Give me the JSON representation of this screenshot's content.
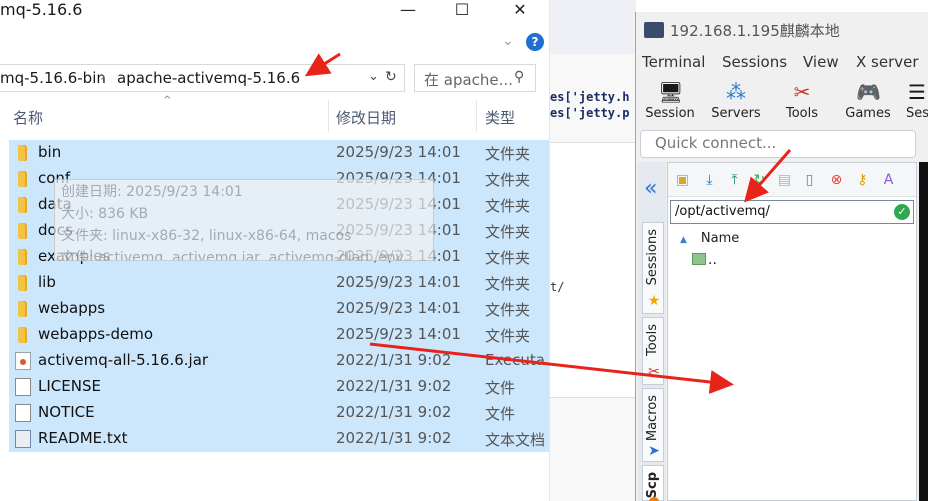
{
  "explorer": {
    "title": "mq-5.16.6",
    "window_controls": [
      "—",
      "☐",
      "✕"
    ],
    "address_segments": [
      "mq-5.16.6-bin",
      "apache-activemq-5.16.6"
    ],
    "address_separator": "›",
    "search_placeholder": "在 apache...",
    "columns": [
      "名称",
      "修改日期",
      "类型"
    ],
    "files": [
      {
        "name": "bin",
        "date": "2025/9/23 14:01",
        "type": "文件夹",
        "icon": "folder-icon"
      },
      {
        "name": "conf",
        "date": "2025/9/23 14:01",
        "type": "文件夹",
        "icon": "folder-icon"
      },
      {
        "name": "data",
        "date": "2025/9/23 14:01",
        "type": "文件夹",
        "icon": "folder-icon"
      },
      {
        "name": "docs",
        "date": "2025/9/23 14:01",
        "type": "文件夹",
        "icon": "folder-icon"
      },
      {
        "name": "examples",
        "date": "2025/9/23 14:01",
        "type": "文件夹",
        "icon": "folder-icon"
      },
      {
        "name": "lib",
        "date": "2025/9/23 14:01",
        "type": "文件夹",
        "icon": "folder-icon"
      },
      {
        "name": "webapps",
        "date": "2025/9/23 14:01",
        "type": "文件夹",
        "icon": "folder-icon"
      },
      {
        "name": "webapps-demo",
        "date": "2025/9/23 14:01",
        "type": "文件夹",
        "icon": "folder-icon"
      },
      {
        "name": "activemq-all-5.16.6.jar",
        "date": "2022/1/31 9:02",
        "type": "Executab",
        "icon": "java-jar-icon"
      },
      {
        "name": "LICENSE",
        "date": "2022/1/31 9:02",
        "type": "文件",
        "icon": "file-icon"
      },
      {
        "name": "NOTICE",
        "date": "2022/1/31 9:02",
        "type": "文件",
        "icon": "file-icon"
      },
      {
        "name": "README.txt",
        "date": "2022/1/31 9:02",
        "type": "文本文档",
        "icon": "text-file-icon"
      }
    ],
    "tooltip": {
      "lines": [
        "创建日期: 2025/9/23 14:01",
        "大小: 836 KB",
        "文件夹: linux-x86-32, linux-x86-64, macos",
        "文件: activemq, activemq.jar, activemq-diag, env"
      ]
    }
  },
  "background_app": {
    "code_lines": [
      "es['jetty.h",
      "es['jetty.p",
      "t/"
    ]
  },
  "moba": {
    "title": "192.168.1.195麒麟本地",
    "menu": [
      "Terminal",
      "Sessions",
      "View",
      "X server"
    ],
    "toolbar": [
      {
        "label": "Session",
        "icon": "monitor-icon"
      },
      {
        "label": "Servers",
        "icon": "servers-icon"
      },
      {
        "label": "Tools",
        "icon": "tools-icon"
      },
      {
        "label": "Games",
        "icon": "gamepad-icon"
      },
      {
        "label": "Ses",
        "icon": "sessions-icon"
      }
    ],
    "quick_connect_placeholder": "Quick connect...",
    "side_tabs": [
      "Sessions",
      "Tools",
      "Macros",
      "Scp"
    ],
    "sftp": {
      "path": "/opt/activemq/",
      "column": "Name",
      "parent_entry": ".."
    }
  },
  "colors": {
    "selection": "#cce6fb",
    "folder": "#f3c343",
    "arrow": "#e8231a",
    "ok_green": "#2fa84f"
  }
}
